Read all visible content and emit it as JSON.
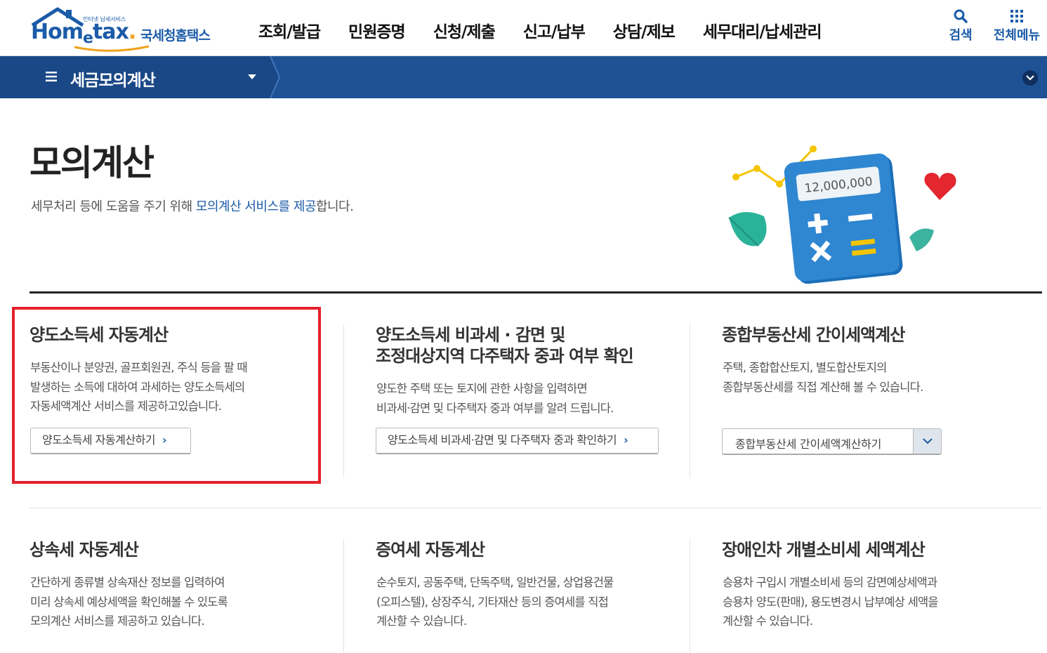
{
  "header": {
    "logo_tag": "인터넷 납세서비스",
    "logo_brand_a": "Hom",
    "logo_brand_e": "e",
    "logo_brand_b": "tax",
    "logo_kr": "국세청홈택스",
    "nav": [
      "조회/발급",
      "민원증명",
      "신청/제출",
      "신고/납부",
      "상담/제보",
      "세무대리/납세관리"
    ],
    "search_label": "검색",
    "allmenu_label": "전체메뉴"
  },
  "subbar": {
    "title": "세금모의계산"
  },
  "intro": {
    "title": "모의계산",
    "desc_prefix": "세무처리 등에 도움을 주기 위해 ",
    "desc_highlight": "모의계산 서비스를 제공",
    "desc_suffix": "합니다.",
    "illust_amount": "12,000,000"
  },
  "cards": [
    {
      "title": "양도소득세 자동계산",
      "desc": "부동산이나 분양권, 골프회원권, 주식 등을 팔 때\n발생하는 소득에 대하여 과세하는 양도소득세의\n자동세액계산 서비스를 제공하고있습니다.",
      "button": "양도소득세 자동계산하기"
    },
    {
      "title_line1": "양도소득세 비과세 · 감면 및",
      "title_line2": "조정대상지역 다주택자 중과 여부 확인",
      "desc": "양도한 주택 또는 토지에 관한 사항을 입력하면\n비과세·감면 및 다주택자 중과 여부를 알려 드립니다.",
      "button": "양도소득세 비과세·감면 및 다주택자 중과 확인하기"
    },
    {
      "title": "종합부동산세 간이세액계산",
      "desc": "주택, 종합합산토지, 별도합산토지의\n종합부동산세를 직접 계산해 볼 수 있습니다.",
      "select_value": "종합부동산세 간이세액계산하기"
    },
    {
      "title": "상속세 자동계산",
      "desc": "간단하게 종류별 상속재산 정보를 입력하여\n미리 상속세 예상세액을 확인해볼 수 있도록\n모의계산 서비스를 제공하고 있습니다."
    },
    {
      "title": "증여세 자동계산",
      "desc": "순수토지, 공동주택, 단독주택, 일반건물, 상업용건물\n(오피스텔), 상장주식, 기타재산 등의 증여세를 직접\n계산할 수 있습니다."
    },
    {
      "title": "장애인차 개별소비세 세액계산",
      "desc": "승용차 구입시 개별소비세 등의 감면예상세액과\n승용차 양도(판매), 용도변경시 납부예상 세액을\n계산할 수 있습니다."
    }
  ]
}
